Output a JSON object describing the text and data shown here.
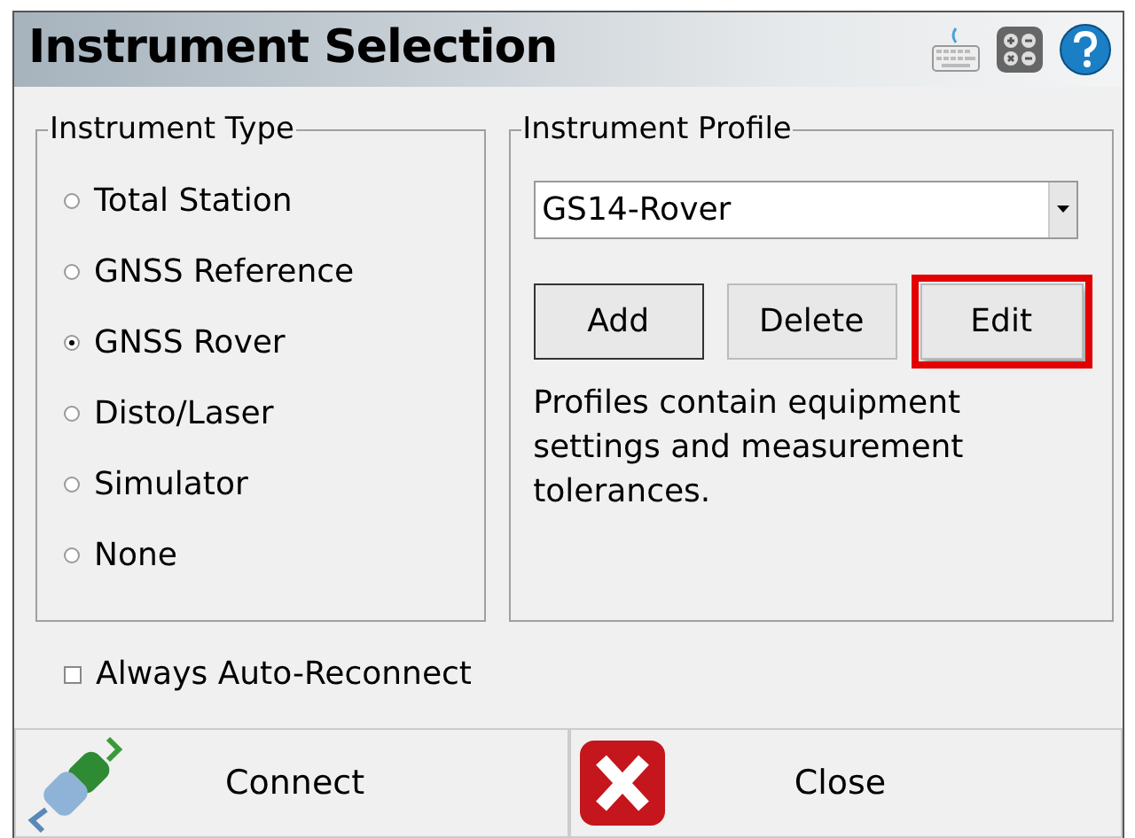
{
  "window": {
    "title": "Instrument Selection"
  },
  "instrument_type": {
    "label": "Instrument Type",
    "options": [
      {
        "label": "Total Station",
        "selected": false
      },
      {
        "label": "GNSS Reference",
        "selected": false
      },
      {
        "label": "GNSS Rover",
        "selected": true
      },
      {
        "label": "Disto/Laser",
        "selected": false
      },
      {
        "label": "Simulator",
        "selected": false
      },
      {
        "label": "None",
        "selected": false
      }
    ]
  },
  "instrument_profile": {
    "label": "Instrument Profile",
    "value": "GS14-Rover",
    "buttons": [
      {
        "label": "Add",
        "default": true,
        "highlighted": false
      },
      {
        "label": "Delete",
        "default": false,
        "highlighted": false
      },
      {
        "label": "Edit",
        "default": false,
        "highlighted": true
      }
    ],
    "description": "Profiles contain equipment settings and measurement tolerances."
  },
  "auto_reconnect": {
    "label": "Always Auto-Reconnect",
    "checked": false
  },
  "footer_buttons": [
    {
      "label": "Connect",
      "kind": "connect"
    },
    {
      "label": "Close",
      "kind": "close"
    }
  ]
}
